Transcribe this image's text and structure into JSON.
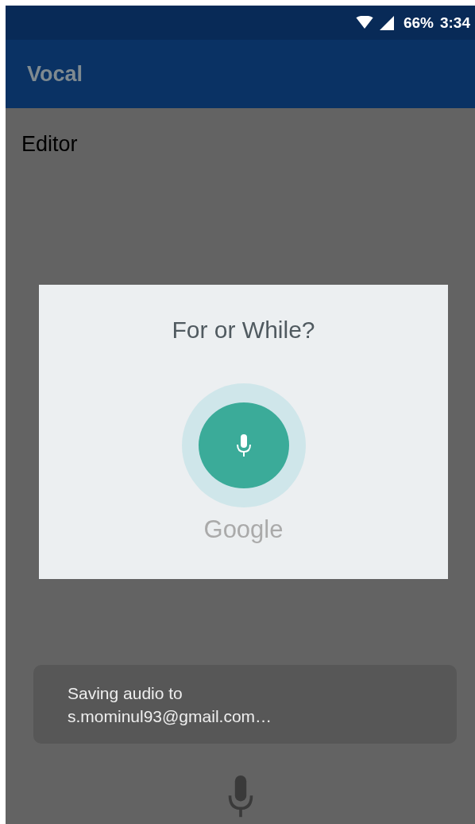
{
  "status_bar": {
    "battery": "66%",
    "time": "3:34"
  },
  "app_bar": {
    "title": "Vocal"
  },
  "editor": {
    "label": "Editor"
  },
  "voice_dialog": {
    "prompt": "For or While?",
    "brand": "Google"
  },
  "toast": {
    "message": "Saving audio to\ns.mominul93@gmail.com…"
  }
}
